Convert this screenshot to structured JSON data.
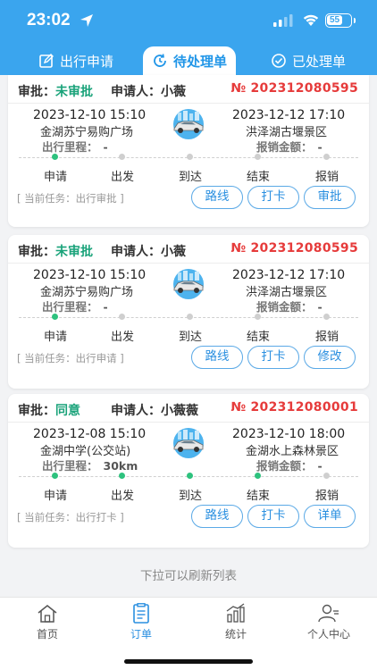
{
  "status_bar": {
    "time": "23:02",
    "battery": "55"
  },
  "tabs": [
    {
      "label": "出行申请",
      "icon": "edit-square-icon"
    },
    {
      "label": "待处理单",
      "icon": "refresh-clock-icon"
    },
    {
      "label": "已处理单",
      "icon": "check-circle-icon"
    }
  ],
  "colors": {
    "primary": "#3aa5ee",
    "approval_green": "#1aa37a",
    "order_red": "#e63b3b",
    "progress_green": "#2ec27e"
  },
  "steps": [
    "申请",
    "出发",
    "到达",
    "结束",
    "报销"
  ],
  "labels": {
    "approval": "审批：",
    "applicant": "申请人：",
    "mileage": "出行里程：",
    "reimburse": "报销金额："
  },
  "orders": [
    {
      "status": "未审批",
      "applicant": "小薇",
      "order_no": "№ 202312080595",
      "start_time": "2023-12-10 15:10",
      "start_place": "金湖苏宁易购广场",
      "end_time": "2023-12-12 17:10",
      "end_place": "洪泽湖古堰景区",
      "mileage": "-",
      "amount": "-",
      "progress_done": 1,
      "task": "[ 当前任务：出行审批 ]",
      "buttons": [
        "路线",
        "打卡",
        "审批"
      ]
    },
    {
      "status": "未审批",
      "applicant": "小薇",
      "order_no": "№ 202312080595",
      "start_time": "2023-12-10 15:10",
      "start_place": "金湖苏宁易购广场",
      "end_time": "2023-12-12 17:10",
      "end_place": "洪泽湖古堰景区",
      "mileage": "-",
      "amount": "-",
      "progress_done": 1,
      "task": "[ 当前任务：出行申请 ]",
      "buttons": [
        "路线",
        "打卡",
        "修改"
      ]
    },
    {
      "status": "同意",
      "applicant": "小薇薇",
      "order_no": "№ 202312080001",
      "start_time": "2023-12-08 15:10",
      "start_place": "金湖中学(公交站)",
      "end_time": "2023-12-10 18:00",
      "end_place": "金湖水上森林景区",
      "mileage": "30km",
      "amount": "-",
      "progress_done": 4,
      "task": "[ 当前任务：出行打卡 ]",
      "buttons": [
        "路线",
        "打卡",
        "详单"
      ]
    }
  ],
  "refresh_hint": "下拉可以刷新列表",
  "bottom_nav": [
    {
      "label": "首页",
      "icon": "home-icon"
    },
    {
      "label": "订单",
      "icon": "order-list-icon"
    },
    {
      "label": "统计",
      "icon": "bar-chart-icon"
    },
    {
      "label": "个人中心",
      "icon": "user-icon"
    }
  ]
}
